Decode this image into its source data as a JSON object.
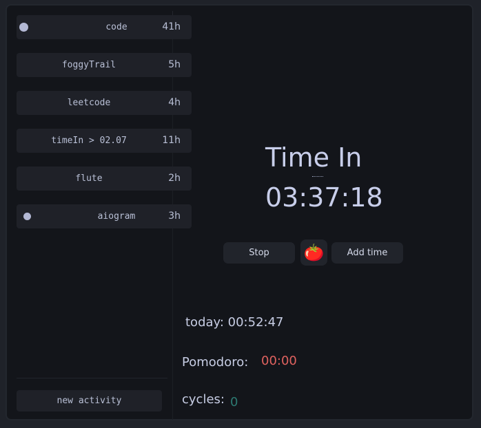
{
  "activities": [
    {
      "name": "code",
      "hours": "41h",
      "indicator": "dot"
    },
    {
      "name": "foggyTrail",
      "hours": "5h"
    },
    {
      "name": "leetcode",
      "hours": "4h"
    },
    {
      "name": "timeIn > 02.07",
      "hours": "11h"
    },
    {
      "name": "flute",
      "hours": "2h"
    },
    {
      "name": "aiogram",
      "hours": "3h",
      "indicator": "dot"
    }
  ],
  "new_activity_label": "new activity",
  "timer": {
    "title": "Time In",
    "clock": "03:37:18"
  },
  "controls": {
    "stop_label": "Stop",
    "tomato_icon": "🍅",
    "add_time_label": "Add time"
  },
  "stats": {
    "today": "today: 00:52:47",
    "pomodoro_label": "Pomodoro:",
    "pomodoro_value": "00:00",
    "cycles_label": "cycles:",
    "cycles_value": "0"
  },
  "colors": {
    "background": "#13151a",
    "card": "#1f2128",
    "text": "#c8ceea",
    "pomodoro": "#e0625f",
    "cycles": "#2d7a72",
    "indicator": "#b3b8d4"
  }
}
